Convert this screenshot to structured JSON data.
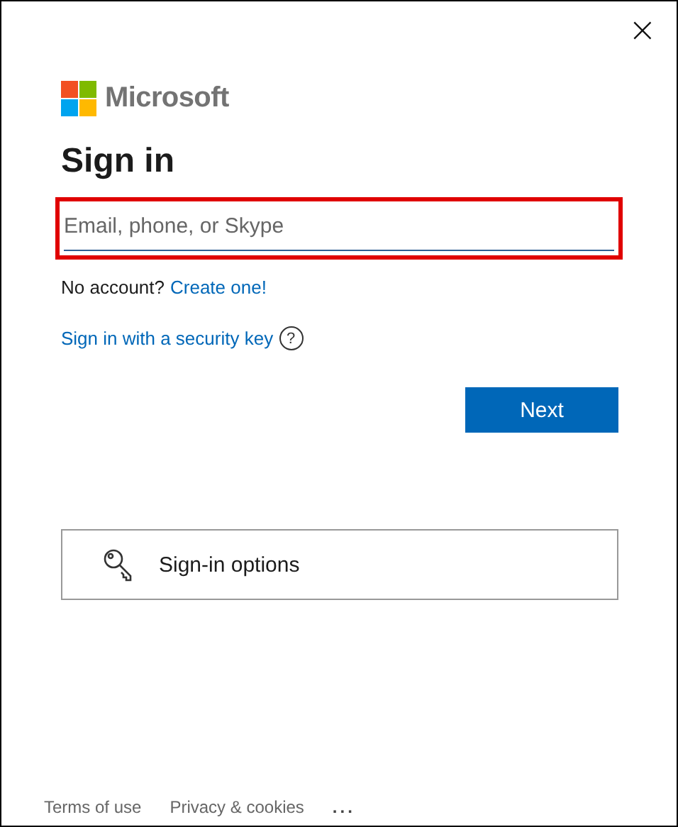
{
  "window": {
    "close": "×"
  },
  "brand": {
    "name": "Microsoft"
  },
  "title": "Sign in",
  "email_field": {
    "placeholder": "Email, phone, or Skype",
    "highlighted": true
  },
  "account_prompt": {
    "text": "No account?",
    "link": "Create one!"
  },
  "security_key_link": {
    "text": "Sign in with a security key",
    "help": "?"
  },
  "next_button": "Next",
  "sign_in_options": "Sign-in options",
  "footer": {
    "links": [
      "Terms of use",
      "Privacy & cookies"
    ],
    "more": "..."
  }
}
